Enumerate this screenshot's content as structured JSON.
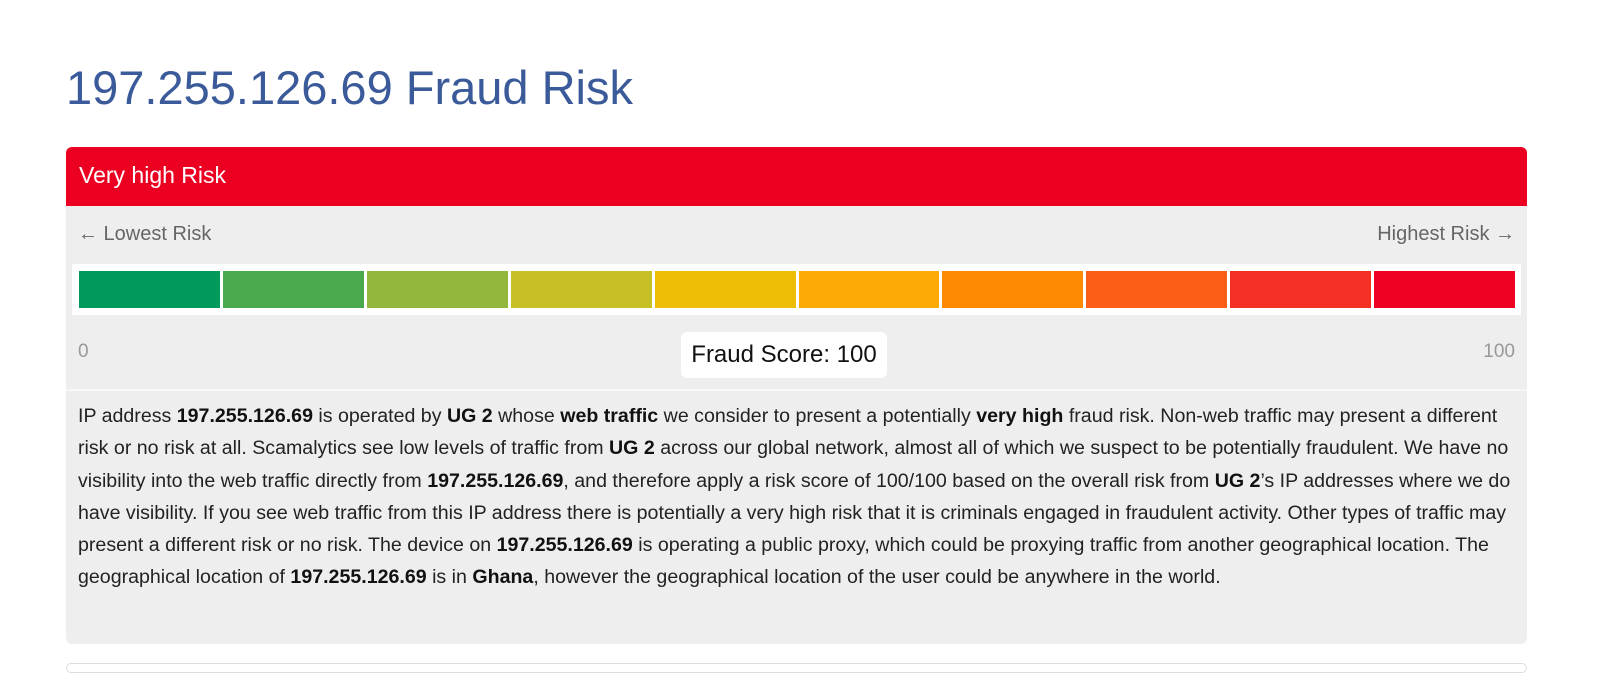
{
  "page": {
    "title": "197.255.126.69 Fraud Risk"
  },
  "risk_card": {
    "header_label": "Very high Risk",
    "header_color": "#ec0021",
    "gauge": {
      "left_label": "← Lowest Risk",
      "right_label": "Highest Risk →",
      "scale_min": "0",
      "scale_max": "100",
      "score_label": "Fraud Score: 100",
      "score_value": 100,
      "segments": [
        {
          "color": "#009a5d"
        },
        {
          "color": "#4aa84d"
        },
        {
          "color": "#93b73c"
        },
        {
          "color": "#c7c024"
        },
        {
          "color": "#ecbf06"
        },
        {
          "color": "#feaa04"
        },
        {
          "color": "#fe8a04"
        },
        {
          "color": "#fc5e18"
        },
        {
          "color": "#f42f24"
        },
        {
          "color": "#ed0021"
        }
      ]
    },
    "description": [
      {
        "text": "IP address ",
        "bold": false
      },
      {
        "text": "197.255.126.69",
        "bold": true
      },
      {
        "text": " is operated by ",
        "bold": false
      },
      {
        "text": "UG 2",
        "bold": true
      },
      {
        "text": " whose ",
        "bold": false
      },
      {
        "text": "web traffic",
        "bold": true
      },
      {
        "text": " we consider to present a potentially ",
        "bold": false
      },
      {
        "text": "very high",
        "bold": true
      },
      {
        "text": " fraud risk. Non-web traffic may present a different risk or no risk at all. Scamalytics see low levels of traffic from ",
        "bold": false
      },
      {
        "text": "UG 2",
        "bold": true
      },
      {
        "text": " across our global network, almost all of which we suspect to be potentially fraudulent. We have no visibility into the web traffic directly from ",
        "bold": false
      },
      {
        "text": "197.255.126.69",
        "bold": true
      },
      {
        "text": ", and therefore apply a risk score of 100/100 based on the overall risk from ",
        "bold": false
      },
      {
        "text": "UG 2",
        "bold": true
      },
      {
        "text": "’s IP addresses where we do have visibility. If you see web traffic from this IP address there is potentially a very high risk that it is criminals engaged in fraudulent activity. Other types of traffic may present a different risk or no risk. The device on ",
        "bold": false
      },
      {
        "text": "197.255.126.69",
        "bold": true
      },
      {
        "text": " is operating a public proxy, which could be proxying traffic from another geographical location. The geographical location of ",
        "bold": false
      },
      {
        "text": "197.255.126.69",
        "bold": true
      },
      {
        "text": " is in ",
        "bold": false
      },
      {
        "text": "Ghana",
        "bold": true
      },
      {
        "text": ", however the geographical location of the user could be anywhere in the world.",
        "bold": false
      }
    ]
  }
}
